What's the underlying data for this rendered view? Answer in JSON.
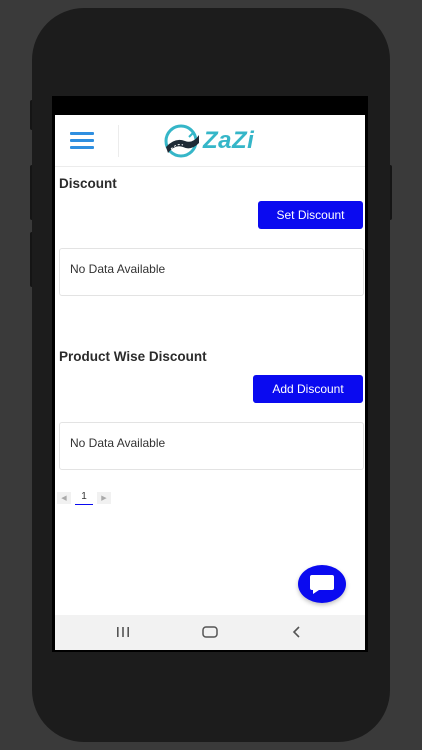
{
  "header": {
    "logo_text": "ZaZi",
    "brand_color": "#35b6c8",
    "menu_icon": "hamburger-icon"
  },
  "discount_section": {
    "title": "Discount",
    "button_label": "Set Discount",
    "empty_text": "No Data Available"
  },
  "product_discount_section": {
    "title": "Product Wise Discount",
    "button_label": "Add Discount",
    "empty_text": "No Data Available"
  },
  "pagination": {
    "current_page": "1",
    "prev_icon": "chevron-left-icon",
    "next_icon": "chevron-right-icon"
  },
  "chat_fab": {
    "icon": "chat-bubble-icon"
  },
  "nav_bar": {
    "icons": [
      "recent-apps-icon",
      "home-icon",
      "back-icon"
    ]
  },
  "colors": {
    "accent": "#0a0af0",
    "menu": "#2f8fe0"
  }
}
